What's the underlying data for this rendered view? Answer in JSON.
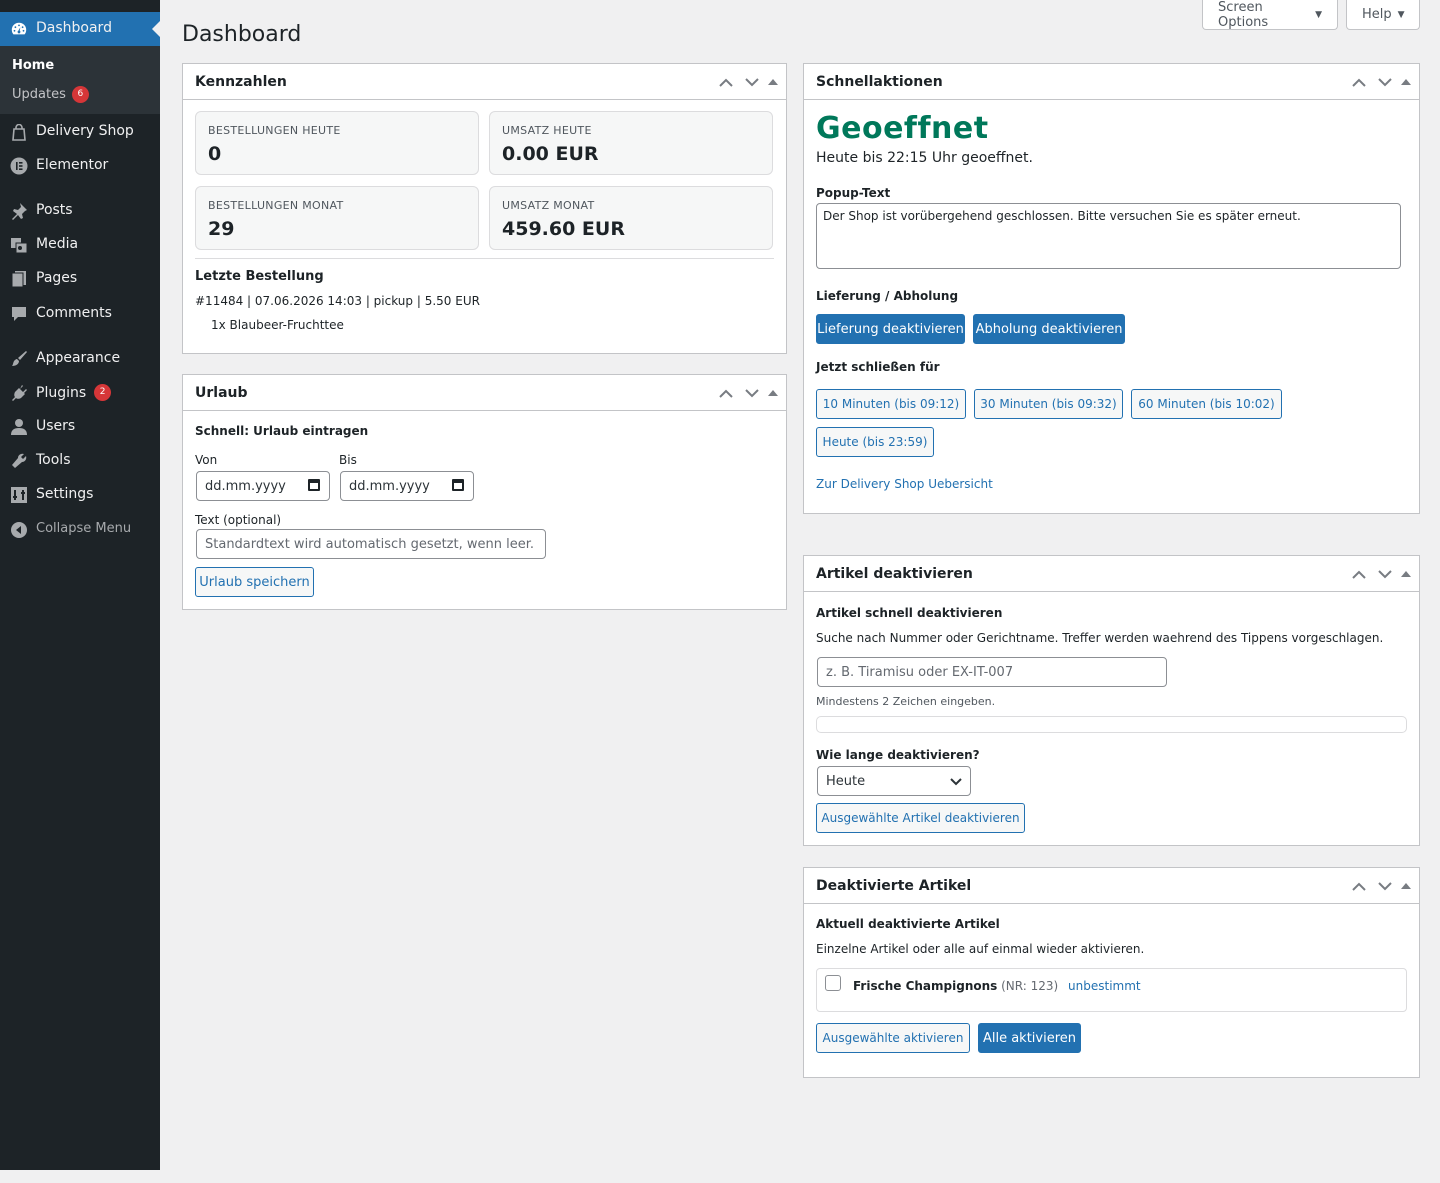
{
  "sidebar": {
    "dashboard": "Dashboard",
    "home": "Home",
    "updates": "Updates",
    "updates_count": "6",
    "items": [
      {
        "label": "Delivery Shop",
        "icon": "bag-icon"
      },
      {
        "label": "Elementor",
        "icon": "elementor-icon"
      },
      {
        "label": "Posts",
        "icon": "pin-icon"
      },
      {
        "label": "Media",
        "icon": "media-icon"
      },
      {
        "label": "Pages",
        "icon": "pages-icon"
      },
      {
        "label": "Comments",
        "icon": "comment-icon"
      },
      {
        "label": "Appearance",
        "icon": "brush-icon"
      },
      {
        "label": "Plugins",
        "icon": "plug-icon"
      },
      {
        "label": "Users",
        "icon": "user-icon"
      },
      {
        "label": "Tools",
        "icon": "wrench-icon"
      },
      {
        "label": "Settings",
        "icon": "settings-icon"
      }
    ],
    "plugins_count": "2",
    "collapse": "Collapse Menu"
  },
  "header": {
    "title": "Dashboard",
    "screen_options": "Screen Options",
    "help": "Help"
  },
  "kennzahlen": {
    "title": "Kennzahlen",
    "stats": [
      {
        "label": "BESTELLUNGEN HEUTE",
        "value": "0"
      },
      {
        "label": "UMSATZ HEUTE",
        "value": "0.00 EUR"
      },
      {
        "label": "BESTELLUNGEN MONAT",
        "value": "29"
      },
      {
        "label": "UMSATZ MONAT",
        "value": "459.60 EUR"
      }
    ],
    "last_order_heading": "Letzte Bestellung",
    "last_order": "#11484 | 07.06.2026 14:03 | pickup | 5.50 EUR",
    "last_order_item": "1x Blaubeer-Fruchttee"
  },
  "urlaub": {
    "title": "Urlaub",
    "heading": "Schnell: Urlaub eintragen",
    "von": "Von",
    "bis": "Bis",
    "date_placeholder": "dd.mm.yyyy",
    "text_label": "Text (optional)",
    "text_placeholder": "Standardtext wird automatisch gesetzt, wenn leer.",
    "save": "Urlaub speichern"
  },
  "schnellaktionen": {
    "title": "Schnellaktionen",
    "status": "Geoeffnet",
    "status_color": "#00785a",
    "status_detail": "Heute bis 22:15 Uhr geoeffnet.",
    "popup_label": "Popup-Text",
    "popup_text": "Der Shop ist vorübergehend geschlossen. Bitte versuchen Sie es später erneut.",
    "lieferung_heading": "Lieferung / Abholung",
    "lieferung_btn": "Lieferung deaktivieren",
    "abholung_btn": "Abholung deaktivieren",
    "close_heading": "Jetzt schließen für",
    "close_buttons": [
      "10 Minuten (bis 09:12)",
      "30 Minuten (bis 09:32)",
      "60 Minuten (bis 10:02)",
      "Heute (bis 23:59)"
    ],
    "overview_link": "Zur Delivery Shop Uebersicht"
  },
  "artikel_deaktivieren": {
    "title": "Artikel deaktivieren",
    "heading": "Artikel schnell deaktivieren",
    "description": "Suche nach Nummer oder Gerichtname. Treffer werden waehrend des Tippens vorgeschlagen.",
    "search_placeholder": "z. B. Tiramisu oder EX-IT-007",
    "hint": "Mindestens 2 Zeichen eingeben.",
    "duration_label": "Wie lange deaktivieren?",
    "duration_value": "Heute",
    "button": "Ausgewählte Artikel deaktivieren"
  },
  "deaktivierte_artikel": {
    "title": "Deaktivierte Artikel",
    "heading": "Aktuell deaktivierte Artikel",
    "description": "Einzelne Artikel oder alle auf einmal wieder aktivieren.",
    "items": [
      {
        "name": "Frische Champignons",
        "nr": "(NR: 123)",
        "duration": "unbestimmt"
      }
    ],
    "activate_selected": "Ausgewählte aktivieren",
    "activate_all": "Alle aktivieren"
  },
  "colors": {
    "accent": "#2271b1",
    "sidebar": "#1d2327",
    "badge": "#d63638"
  }
}
